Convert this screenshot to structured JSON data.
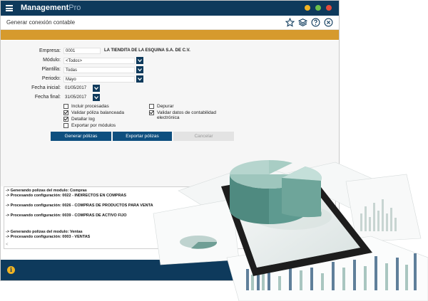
{
  "app": {
    "brand_main": "Management",
    "brand_sub": "Pro"
  },
  "window_dots": {
    "colors": [
      "#f0b323",
      "#6cbf4a",
      "#e34b3c"
    ]
  },
  "header": {
    "title": "Generar conexión contable"
  },
  "toolbar": {
    "icons": [
      "star-icon",
      "layers-icon",
      "help-icon",
      "close-icon"
    ]
  },
  "form": {
    "empresa": {
      "label": "Empresa:",
      "code": "0001",
      "name": "LA TIENDITA DE LA ESQUINA S.A. DE C.V."
    },
    "modulo": {
      "label": "Módulo:",
      "value": "<Todos>"
    },
    "plantilla": {
      "label": "Plantilla:",
      "value": "Todas"
    },
    "periodo": {
      "label": "Periodo:",
      "value": "Mayo"
    },
    "fecha_inicial": {
      "label": "Fecha inicial:",
      "value": "01/05/2017"
    },
    "fecha_final": {
      "label": "Fecha final:",
      "value": "31/05/2017"
    }
  },
  "options": {
    "incluir_procesadas": {
      "label": "Incluir procesadas",
      "checked": false
    },
    "validar_poliza": {
      "label": "Validar póliza balanceada",
      "checked": true
    },
    "detallar_log": {
      "label": "Detallar log",
      "checked": true
    },
    "exportar_modulos": {
      "label": "Exportar por módulos",
      "checked": false
    },
    "depurar": {
      "label": "Depurar",
      "checked": false
    },
    "validar_datos_line1": "Validar datos de contabilidad",
    "validar_datos_line2": "electrónica",
    "validar_datos_checked": true
  },
  "buttons": {
    "generar": "Generar pólizas",
    "exportar": "Exportar pólizas",
    "cancelar": "Cancelar"
  },
  "log": [
    "-> Generando polizas del modulo: Compras",
    "-> Procesando configuración: 0022 - INDIRECTOS EN COMPRAS",
    "-> Procesando configuración: 0026 - COMPRAS DE PRODUCTOS PARA VENTA",
    "-> Procesando configuración: 0039 - COMPRAS DE ACTIVO FIJO",
    "-> Generando polizas del modulo: Ventas",
    "-> Procesando configuración: 0003 - VENTAS"
  ]
}
